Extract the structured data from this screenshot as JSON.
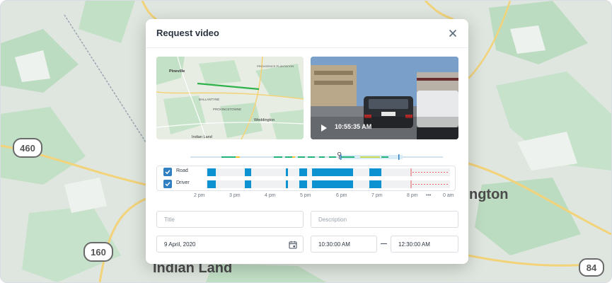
{
  "modal": {
    "title": "Request video",
    "close_icon": "close-icon"
  },
  "map": {
    "labels": [
      "Pineville",
      "PROVIDENCE PLANTATION",
      "BALLANTYNE",
      "PROVINCETOWNE",
      "Weddington",
      "Indian Land"
    ],
    "route_color": "#2eb24a"
  },
  "video": {
    "time": "10:55:35 AM",
    "play_icon": "play-icon"
  },
  "scrubber": {
    "progress": 0.59
  },
  "tracks": [
    {
      "label": "Road",
      "checked": true
    },
    {
      "label": "Driver",
      "checked": true
    }
  ],
  "timeline": {
    "ticks": [
      "2 pm",
      "3 pm",
      "4 pm",
      "5 pm",
      "6 pm",
      "7 pm",
      "8 pm",
      "•••",
      "0 am"
    ],
    "bar_color": "#0c92d0"
  },
  "form": {
    "title_placeholder": "Title",
    "description_placeholder": "Description",
    "date_value": "9 April, 2020",
    "start_time": "10:30:00 AM",
    "end_time": "12:30:00 AM",
    "calendar_icon": "calendar-icon"
  },
  "background_map": {
    "labels": [
      "460",
      "160",
      "84",
      "Indian Land",
      "ngton"
    ]
  }
}
